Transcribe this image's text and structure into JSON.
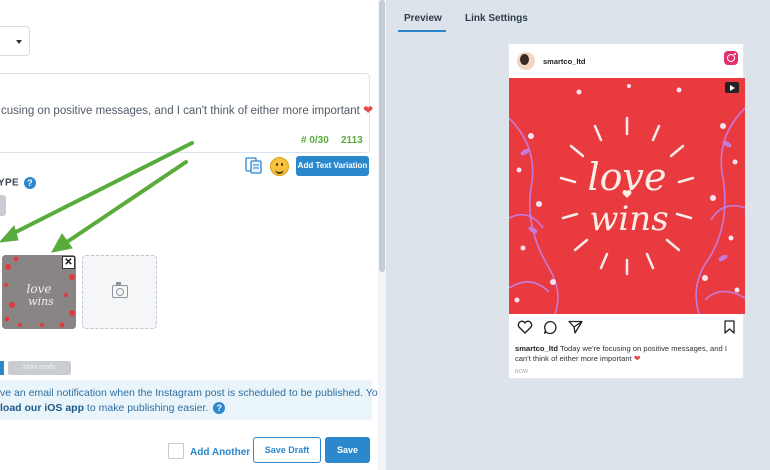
{
  "composer": {
    "message_excerpt": "cusing on positive messages, and I can't think of either more important",
    "counter_hashtags": "# 0/30",
    "counter_chars": "2113",
    "add_text_variation_label": "Add Text Variation",
    "type_label": "YPE",
    "help_glyph": "?",
    "media": {
      "thumbnail_text": "love wins",
      "close_glyph": "✕",
      "add_media_icon": "camera-icon"
    },
    "notice": {
      "line1": "ve an email notification when the Instagram post is scheduled to be published. You may",
      "line2_bold": "load our iOS app",
      "line2_rest": " to make publishing easier."
    },
    "footer": {
      "add_another_label": "Add Another",
      "save_draft_label": "Save Draft",
      "save_label": "Save"
    },
    "tab_fragment_label": "Now really"
  },
  "preview_panel": {
    "tabs": [
      {
        "label": "Preview",
        "active": true
      },
      {
        "label": "Link Settings",
        "active": false
      }
    ],
    "post": {
      "username": "smartco_ltd",
      "image_text_line1": "love",
      "image_text_line2": "wins",
      "caption_user": "smartco_ltd",
      "caption_text": " Today we're focusing on positive messages, and I can't think of either more important",
      "timestamp": "NOW"
    }
  },
  "colors": {
    "accent": "#2b88cc",
    "arrow": "#5aab3d",
    "post_red": "#e93a3f",
    "counter_green": "#5aab3d"
  }
}
